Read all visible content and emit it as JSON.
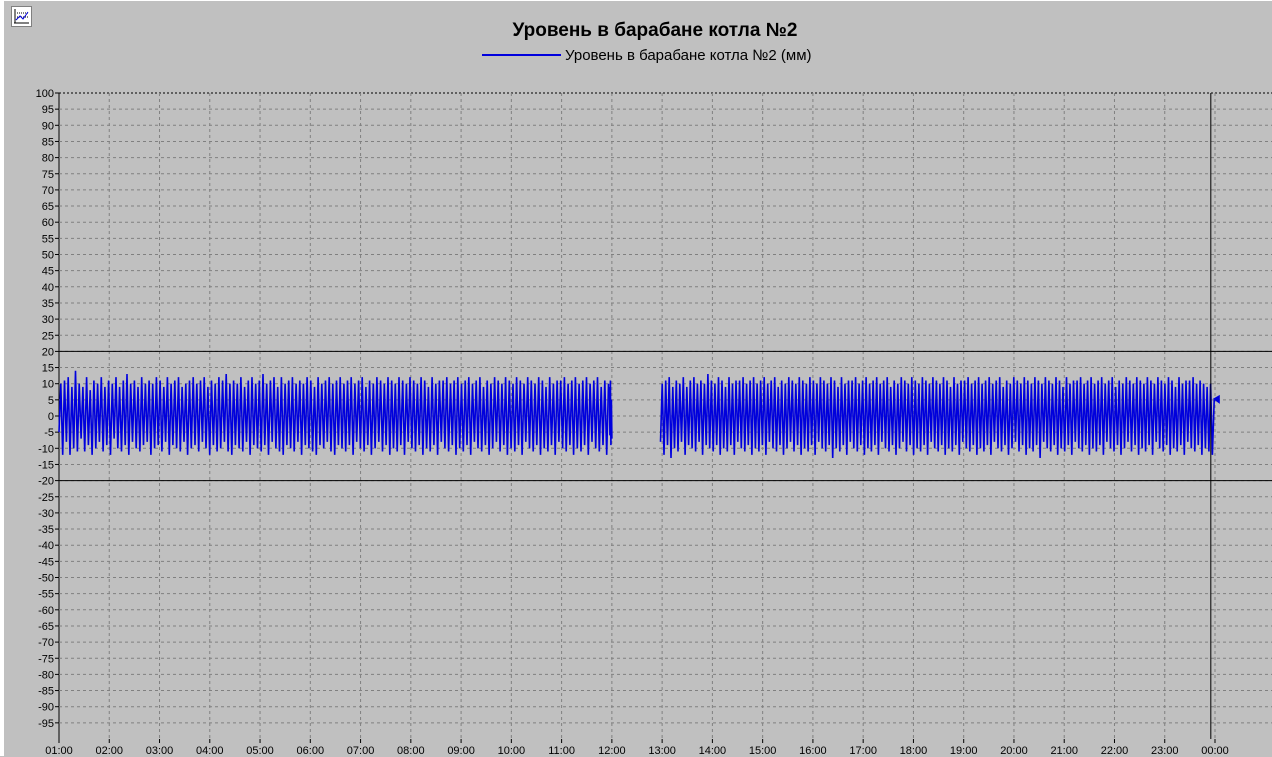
{
  "toolbar": {
    "settings_icon": "chart-settings-icon"
  },
  "colors": {
    "background": "#c0c0c0",
    "series": "#0000dd",
    "grid": "#808080",
    "limit_lines": "#000000"
  },
  "chart_data": {
    "type": "line",
    "title": "Уровень в барабане котла №2",
    "legend_position": "top-center",
    "grid": true,
    "ylim": [
      -100,
      100
    ],
    "y_ticks": [
      100,
      95,
      90,
      85,
      80,
      75,
      70,
      65,
      60,
      55,
      50,
      45,
      40,
      35,
      30,
      25,
      20,
      15,
      10,
      5,
      0,
      -5,
      -10,
      -15,
      -20,
      -25,
      -30,
      -35,
      -40,
      -45,
      -50,
      -55,
      -60,
      -65,
      -70,
      -75,
      -80,
      -85,
      -90,
      -95
    ],
    "x_ticks": [
      "01:00",
      "02:00",
      "03:00",
      "04:00",
      "05:00",
      "06:00",
      "07:00",
      "08:00",
      "09:00",
      "10:00",
      "11:00",
      "12:00",
      "13:00",
      "14:00",
      "15:00",
      "16:00",
      "17:00",
      "18:00",
      "19:00",
      "20:00",
      "21:00",
      "22:00",
      "23:00",
      "00:00"
    ],
    "xlim": [
      "01:00",
      "00:00"
    ],
    "limit_lines": [
      20,
      -20
    ],
    "current_time_marker": "23:55",
    "current_value_marker": 5,
    "series": [
      {
        "name": "Уровень в барабане котла №2 (мм)",
        "description_range": [
          -13,
          14
        ],
        "segments": [
          {
            "start": "01:00",
            "end": "11:56",
            "y": [
              -5,
              10,
              -12,
              11,
              -8,
              12,
              -12,
              9,
              -10,
              14,
              -11,
              10,
              -7,
              9,
              -11,
              12,
              -9,
              8,
              -12,
              11,
              -10,
              10,
              -8,
              12,
              -11,
              9,
              -9,
              11,
              -12,
              10,
              -7,
              12,
              -10,
              9,
              -11,
              11,
              -9,
              13,
              -12,
              10,
              -8,
              11,
              -10,
              9,
              -11,
              12,
              -9,
              10,
              -8,
              11,
              -12,
              10,
              -10,
              12,
              -9,
              11,
              -11,
              9,
              -8,
              12,
              -12,
              10,
              -9,
              11,
              -10,
              12,
              -11,
              9,
              -8,
              10,
              -12,
              11,
              -10,
              12,
              -9,
              10,
              -11,
              11,
              -8,
              12,
              -10,
              9,
              -12,
              11,
              -9,
              10,
              -11,
              12,
              -10,
              11,
              -8,
              13,
              -11,
              10,
              -12,
              11,
              -9,
              10,
              -10,
              12,
              -11,
              9,
              -8,
              11,
              -12,
              12,
              -9,
              10,
              -10,
              11,
              -11,
              13,
              -9,
              10,
              -12,
              11,
              -8,
              12,
              -10,
              9,
              -11,
              12,
              -12,
              10,
              -9,
              11,
              -10,
              12,
              -11,
              10,
              -8,
              11,
              -12,
              10,
              -9,
              12,
              -10,
              11,
              -11,
              9,
              -12,
              12,
              -9,
              10,
              -10,
              11,
              -8,
              12,
              -11,
              10,
              -12,
              11,
              -9,
              12,
              -10,
              10,
              -11,
              11,
              -9,
              12,
              -12,
              10,
              -8,
              11,
              -10,
              12,
              -11,
              9,
              -9,
              11,
              -12,
              10,
              -10,
              12,
              -8,
              11,
              -11,
              10,
              -9,
              12,
              -12,
              11,
              -10,
              10,
              -11,
              12,
              -9,
              11,
              -12,
              10,
              -8,
              12,
              -10,
              11,
              -11,
              10,
              -9,
              12,
              -12,
              11,
              -10,
              9,
              -11,
              12,
              -9,
              10,
              -12,
              11,
              -8,
              11,
              -10,
              12,
              -11,
              10,
              -9,
              11,
              -12,
              12,
              -10,
              10,
              -11,
              11,
              -9,
              12,
              -12,
              10,
              -8,
              11,
              -10,
              12,
              -11,
              9,
              -9,
              11,
              -12,
              10,
              -10,
              12,
              -8,
              11,
              -11,
              10,
              -9,
              12,
              -12,
              11,
              -10,
              10,
              -11,
              12,
              -9,
              11,
              -12,
              10,
              -8,
              12,
              -10,
              11,
              -11,
              10,
              -9,
              12,
              -12,
              11,
              -10,
              9,
              -11,
              12,
              -9,
              10,
              -12,
              11,
              -8,
              11,
              -10,
              12,
              -11,
              10,
              -9,
              11,
              -12,
              12,
              -10,
              10,
              -11,
              11,
              -9,
              12,
              -12,
              10,
              -8,
              11,
              -10,
              12,
              -11,
              9,
              -9,
              11,
              -12,
              10
            ]
          },
          {
            "start": "11:57",
            "end": "12:00",
            "y": [
              9,
              -6,
              11,
              -9,
              5,
              -7
            ]
          },
          {
            "start": "12:58",
            "end": "23:59",
            "y": [
              -8,
              10,
              -12,
              11,
              -9,
              12,
              -13,
              9,
              -10,
              11,
              -11,
              10,
              -8,
              12,
              -12,
              9,
              -9,
              11,
              -10,
              12,
              -11,
              10,
              -8,
              11,
              -12,
              10,
              -9,
              13,
              -10,
              11,
              -11,
              10,
              -9,
              12,
              -12,
              11,
              -10,
              9,
              -11,
              12,
              -9,
              10,
              -12,
              11,
              -8,
              11,
              -10,
              12,
              -11,
              10,
              -9,
              11,
              -12,
              12,
              -10,
              10,
              -11,
              11,
              -9,
              12,
              -12,
              10,
              -8,
              11,
              -10,
              12,
              -11,
              9,
              -9,
              11,
              -12,
              10,
              -10,
              12,
              -8,
              11,
              -11,
              10,
              -9,
              12,
              -12,
              11,
              -10,
              10,
              -11,
              12,
              -9,
              11,
              -12,
              10,
              -8,
              12,
              -10,
              11,
              -11,
              10,
              -9,
              12,
              -13,
              11,
              -10,
              9,
              -11,
              12,
              -9,
              10,
              -12,
              11,
              -8,
              11,
              -10,
              12,
              -11,
              10,
              -9,
              11,
              -12,
              12,
              -10,
              10,
              -11,
              11,
              -9,
              12,
              -12,
              10,
              -8,
              11,
              -10,
              12,
              -11,
              9,
              -9,
              11,
              -12,
              10,
              -10,
              12,
              -8,
              11,
              -11,
              10,
              -9,
              12,
              -12,
              11,
              -10,
              10,
              -11,
              12,
              -9,
              11,
              -12,
              10,
              -8,
              12,
              -10,
              11,
              -11,
              10,
              -9,
              12,
              -12,
              11,
              -10,
              9,
              -11,
              12,
              -9,
              10,
              -12,
              11,
              -8,
              11,
              -10,
              12,
              -11,
              10,
              -9,
              11,
              -12,
              12,
              -10,
              10,
              -11,
              11,
              -9,
              12,
              -12,
              10,
              -8,
              11,
              -10,
              12,
              -11,
              9,
              -9,
              11,
              -12,
              10,
              -10,
              12,
              -8,
              11,
              -11,
              10,
              -9,
              12,
              -12,
              11,
              -10,
              10,
              -11,
              12,
              -9,
              11,
              -13,
              10,
              -8,
              12,
              -10,
              11,
              -11,
              10,
              -9,
              12,
              -12,
              11,
              -10,
              9,
              -11,
              12,
              -9,
              10,
              -12,
              11,
              -8,
              11,
              -10,
              12,
              -11,
              10,
              -9,
              11,
              -12,
              12,
              -10,
              10,
              -11,
              11,
              -9,
              12,
              -12,
              10,
              -8,
              11,
              -10,
              12,
              -11,
              9,
              -9,
              11,
              -12,
              10,
              -10,
              12,
              -8,
              11,
              -11,
              10,
              -9,
              12,
              -12,
              11,
              -10,
              10,
              -11,
              12,
              -9,
              11,
              -12,
              10,
              -8,
              12,
              -10,
              11,
              -11,
              10,
              -9,
              12,
              -12,
              11,
              -10,
              9,
              -11,
              12,
              -9,
              10,
              -12,
              11,
              -8,
              11,
              -10,
              12,
              -11,
              10,
              -9,
              11,
              -12,
              10,
              -10,
              9,
              -11,
              10,
              -12,
              5
            ]
          }
        ]
      }
    ]
  }
}
